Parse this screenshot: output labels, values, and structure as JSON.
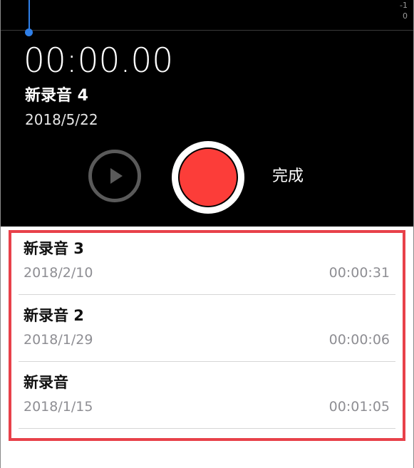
{
  "recorder": {
    "db_scale": [
      "-1",
      "0"
    ],
    "timer": "00:00.00",
    "title": "新录音 4",
    "date": "2018/5/22",
    "done_label": "完成",
    "accent_color": "#2f7fe8",
    "record_color": "#fc3d39"
  },
  "recordings": [
    {
      "name": "新录音 3",
      "date": "2018/2/10",
      "duration": "00:00:31"
    },
    {
      "name": "新录音 2",
      "date": "2018/1/29",
      "duration": "00:00:06"
    },
    {
      "name": "新录音",
      "date": "2018/1/15",
      "duration": "00:01:05"
    }
  ],
  "highlight_color": "#e8414a"
}
